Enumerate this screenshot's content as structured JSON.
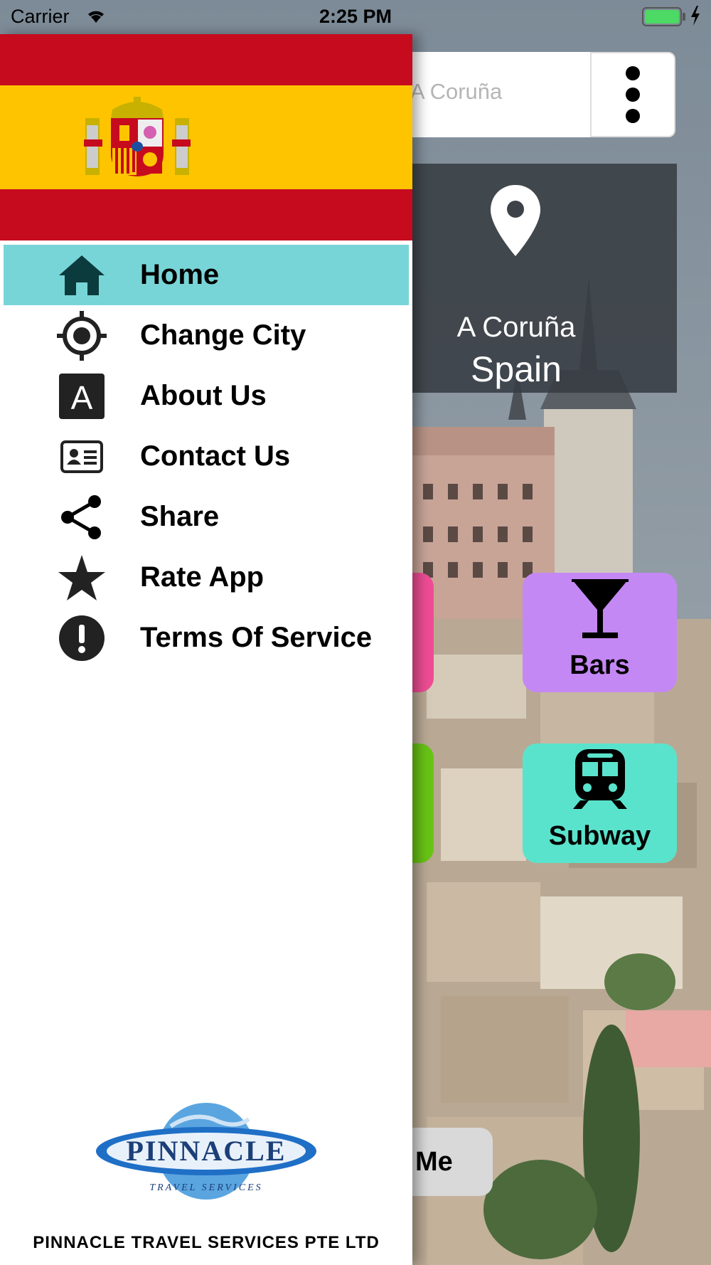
{
  "status_bar": {
    "carrier": "Carrier",
    "time": "2:25 PM",
    "battery_color": "#4cd964"
  },
  "search": {
    "placeholder": "A Coruña"
  },
  "location": {
    "city": "A Coruña",
    "country": "Spain",
    "icon": "map-pin-icon"
  },
  "tiles": [
    {
      "label": "",
      "color": "#ee4d95"
    },
    {
      "label": "Bars",
      "icon": "cocktail-icon",
      "color": "#c488f4"
    },
    {
      "label": "",
      "color": "#68c416"
    },
    {
      "label": "Subway",
      "icon": "subway-icon",
      "color": "#5ae3cc"
    }
  ],
  "me_button": {
    "label": "Me"
  },
  "drawer": {
    "header": "spain-flag",
    "items": [
      {
        "label": "Home",
        "icon": "home-icon",
        "active": true
      },
      {
        "label": "Change City",
        "icon": "crosshair-icon"
      },
      {
        "label": "About Us",
        "icon": "letter-a-icon"
      },
      {
        "label": "Contact Us",
        "icon": "contact-card-icon"
      },
      {
        "label": "Share",
        "icon": "share-icon"
      },
      {
        "label": "Rate App",
        "icon": "star-icon"
      },
      {
        "label": "Terms Of Service",
        "icon": "exclamation-icon"
      }
    ],
    "active_color": "#78d5d7",
    "logo_text": "PINNACLE",
    "logo_subtext": "TRAVEL SERVICES",
    "company_name": "PINNACLE TRAVEL SERVICES PTE LTD"
  }
}
